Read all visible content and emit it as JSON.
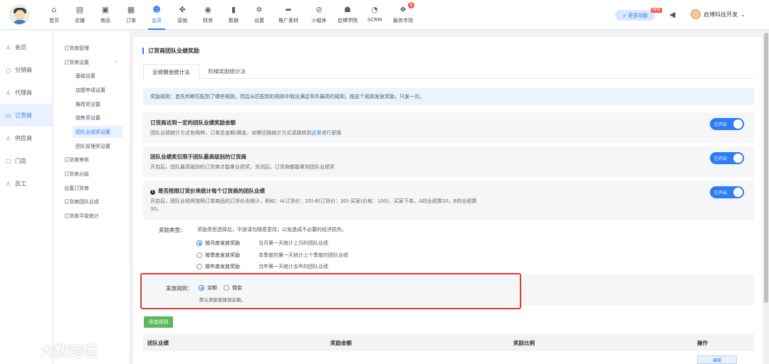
{
  "nav": [
    {
      "label": "首页",
      "icon": "home-icon",
      "glyph": "⌂"
    },
    {
      "label": "店铺",
      "icon": "store-icon",
      "glyph": "▤"
    },
    {
      "label": "商品",
      "icon": "goods-icon",
      "glyph": "▣"
    },
    {
      "label": "订单",
      "icon": "order-icon",
      "glyph": "▦"
    },
    {
      "label": "会员",
      "icon": "member-icon",
      "glyph": "☻",
      "active": true
    },
    {
      "label": "营销",
      "icon": "marketing-icon",
      "glyph": "✤"
    },
    {
      "label": "财务",
      "icon": "finance-icon",
      "glyph": "◉"
    },
    {
      "label": "数据",
      "icon": "data-icon",
      "glyph": "▮"
    },
    {
      "label": "设置",
      "icon": "settings-icon",
      "glyph": "✲"
    },
    {
      "label": "推广素材",
      "icon": "share-icon",
      "glyph": "➦"
    },
    {
      "label": "小程序",
      "icon": "miniprogram-icon",
      "glyph": "⊘"
    },
    {
      "label": "启博学院",
      "icon": "academy-icon",
      "glyph": "☗"
    },
    {
      "label": "SCRM",
      "icon": "scrm-icon",
      "glyph": "◔"
    },
    {
      "label": "服务市场",
      "icon": "market-icon",
      "glyph": "❖",
      "badge": "8"
    }
  ],
  "header": {
    "more_label": "更多功能",
    "new_tag": "NEW",
    "user_name": "启博科技开发"
  },
  "sidebar1": [
    {
      "label": "会员",
      "glyph": "♙"
    },
    {
      "label": "分销商",
      "glyph": "▢"
    },
    {
      "label": "代理商",
      "glyph": "♙"
    },
    {
      "label": "订货商",
      "glyph": "▭",
      "active": true
    },
    {
      "label": "供应商",
      "glyph": "♙"
    },
    {
      "label": "门店",
      "glyph": "▢"
    },
    {
      "label": "员工",
      "glyph": "♙"
    }
  ],
  "sidebar2": [
    {
      "label": "订货商管理"
    },
    {
      "label": "订货商设置",
      "arrow": "›"
    },
    {
      "label": "基础设置",
      "sub": true
    },
    {
      "label": "加盟申请设置",
      "sub": true
    },
    {
      "label": "推荐奖设置",
      "sub": true
    },
    {
      "label": "销售奖设置",
      "sub": true
    },
    {
      "label": "团队业绩奖设置",
      "sub": true,
      "active": true
    },
    {
      "label": "团队管理奖设置",
      "sub": true
    },
    {
      "label": "订货商审核"
    },
    {
      "label": "订货商分组"
    },
    {
      "label": "设置订货商"
    },
    {
      "label": "订货商团队业绩"
    },
    {
      "label": "订货商平级统计"
    }
  ],
  "main": {
    "title": "订货商团队业绩奖励",
    "tabs": [
      "业绩佣金统计法",
      "阶梯奖励统计法"
    ],
    "notice": "奖励规则：首先判断匹配到了哪些规则，然后从匹配到的规则中取出满足条件最高的规则，按这个规则发放奖励，只发一次。",
    "card1": {
      "title": "订货商达到一定的团队业绩奖励金额",
      "desc_pre": "团队业绩统计方式有两种，订单总金额/佣金，如需切换统计方式请跳转到",
      "desc_link": "这里",
      "desc_post": "进行更换",
      "toggle": "已开启"
    },
    "card2": {
      "title": "团队业绩奖仅限于团队最高级别的订货商",
      "desc": "开启后，团队最高级别的订货商才能拿业绩奖，关闭后，订货商都能拿到团队业绩奖",
      "toggle": "已开启"
    },
    "card3": {
      "title": "是否按照订货价来统计每个订货商的团队业绩",
      "desc": "开启后，团队业绩将按照订单商品的订货价去统计，例如：A(订货价：20)-B(订货价：30)-买家(价格：100)，买家下单，A的业绩算20，B的业绩算30。",
      "toggle": "已开启"
    },
    "reward_type": {
      "label": "奖励类型：",
      "hint": "奖励类型选择后，中途请勿随意更改，以免造成不必要的经济损失。",
      "options": [
        {
          "label": "按月度发放奖励",
          "desc": "当月第一天统计上月的团队业绩",
          "checked": true
        },
        {
          "label": "按季度发放奖励",
          "desc": "本季度的第一天统计上个季度的团队业绩"
        },
        {
          "label": "按年度发放奖励",
          "desc": "当年第一天统计去年的团队业绩"
        }
      ]
    },
    "release": {
      "label": "发放规则：",
      "options": [
        {
          "label": "余额",
          "checked": true
        },
        {
          "label": "佣金"
        }
      ],
      "hint": "默认奖励发放到余额。"
    },
    "add_button": "添加规则",
    "table_headers": [
      "团队业绩",
      "奖励金额",
      "奖励比例",
      "操作"
    ],
    "edit_button": "编辑"
  },
  "watermark": "大数跨境"
}
